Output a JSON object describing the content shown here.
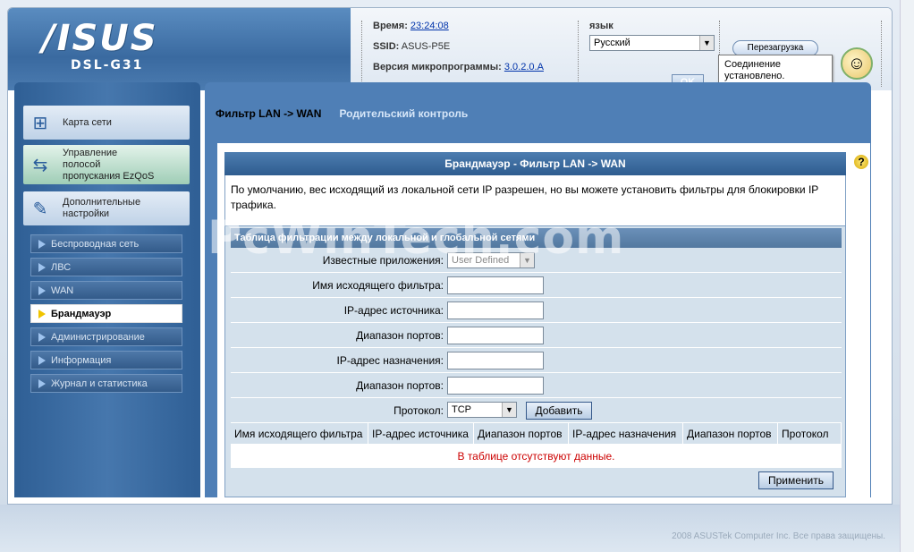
{
  "header": {
    "brand": "/ISUS",
    "model": "DSL-G31",
    "time_label": "Время:",
    "time_value": "23:24:08",
    "ssid_label": "SSID:",
    "ssid_value": "ASUS-P5E",
    "fw_label": "Версия микропрограммы:",
    "fw_value": "3.0.2.0.A",
    "lang_label": "язык",
    "lang_value": "Русский",
    "ok_label": "OK",
    "reboot_label": "Перезагрузка",
    "tooltip": "Соединение установлено."
  },
  "sidebar": {
    "main_items": [
      {
        "label": "Карта сети",
        "icon": "network-map-icon"
      },
      {
        "label": "Управление полосой пропускания EzQoS",
        "icon": "bandwidth-icon"
      },
      {
        "label": "Дополнительные настройки",
        "icon": "tools-icon"
      }
    ],
    "sub_items": [
      {
        "label": "Беспроводная сеть",
        "active": false
      },
      {
        "label": "ЛВС",
        "active": false
      },
      {
        "label": "WAN",
        "active": false
      },
      {
        "label": "Брандмауэр",
        "active": true
      },
      {
        "label": "Администрирование",
        "active": false
      },
      {
        "label": "Информация",
        "active": false
      },
      {
        "label": "Журнал и статистика",
        "active": false
      }
    ]
  },
  "tabs": [
    {
      "label": "Фильтр LAN -> WAN",
      "active": true
    },
    {
      "label": "Родительский контроль",
      "active": false
    }
  ],
  "panel": {
    "title": "Брандмауэр - Фильтр LAN -> WAN",
    "description": "По умолчанию, вес исходящий из локальной сети IP разрешен, но вы можете установить фильтры для блокировки IP трафика.",
    "table_title": "Таблица фильтрации между локальной и глобальной сетями",
    "fields": {
      "known_apps_label": "Известные приложения:",
      "known_apps_value": "User Defined",
      "filter_name_label": "Имя исходящего фильтра:",
      "src_ip_label": "IP-адрес источника:",
      "src_ports_label": "Диапазон портов:",
      "dst_ip_label": "IP-адрес назначения:",
      "dst_ports_label": "Диапазон портов:",
      "protocol_label": "Протокол:",
      "protocol_value": "TCP",
      "add_label": "Добавить"
    },
    "columns": [
      "Имя исходящего фильтра",
      "IP-адрес источника",
      "Диапазон портов",
      "IP-адрес назначения",
      "Диапазон портов",
      "Протокол"
    ],
    "empty_text": "В таблице отсутствуют данные.",
    "apply_label": "Применить"
  },
  "watermark": "PcWinTech.com",
  "footer": "2008 ASUSTek Computer Inc. Все права защищены."
}
